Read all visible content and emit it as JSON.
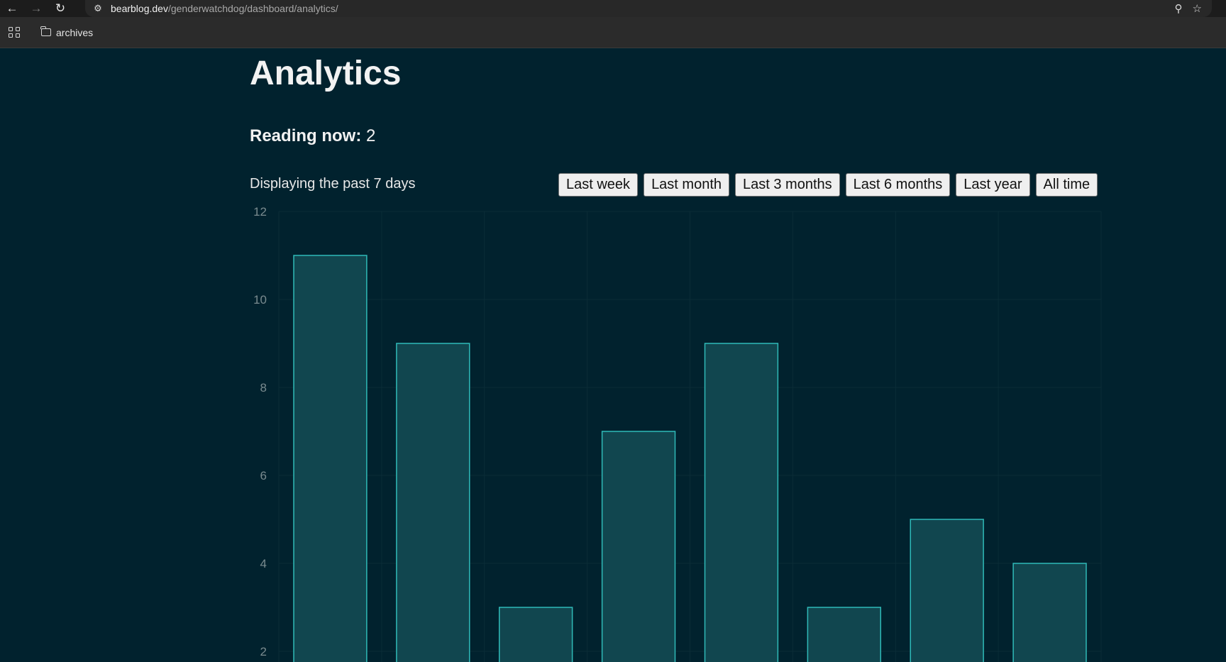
{
  "browser": {
    "url_host": "bearblog.dev",
    "url_path": "/genderwatchdog/dashboard/analytics/",
    "bookmarks": [
      {
        "label": "archives",
        "icon": "folder-icon"
      }
    ]
  },
  "page": {
    "title": "Analytics",
    "reading_now_label": "Reading now:",
    "reading_now_value": "2",
    "displaying_text": "Displaying the past 7 days",
    "range_buttons": [
      "Last week",
      "Last month",
      "Last 3 months",
      "Last 6 months",
      "Last year",
      "All time"
    ]
  },
  "colors": {
    "background": "#01222e",
    "bar_fill": "#11464f",
    "bar_stroke": "#2fbab8",
    "tick_text": "#7a8b8f"
  },
  "chart_data": {
    "type": "bar",
    "values": [
      11,
      9,
      3,
      7,
      9,
      3,
      5,
      4
    ],
    "ylim": [
      0,
      12
    ],
    "y_ticks": [
      2,
      4,
      6,
      8,
      10,
      12
    ],
    "grid": true,
    "xlabel": "",
    "ylabel": ""
  }
}
